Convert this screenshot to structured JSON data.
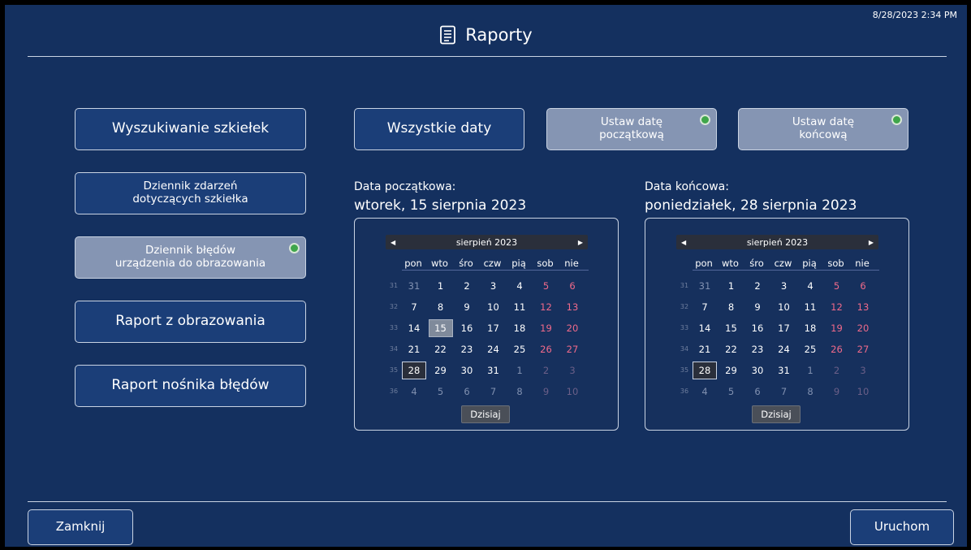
{
  "timestamp": "8/28/2023 2:34 PM",
  "header": {
    "title": "Raporty",
    "icon": "report-document-icon"
  },
  "left_menu": [
    {
      "id": "wyszukiwanie",
      "label": "Wyszukiwanie szkiełek",
      "size": "big",
      "dim": false,
      "indicator": false
    },
    {
      "id": "dziennik-zdarzen",
      "label_lines": [
        "Dziennik zdarzeń",
        "dotyczących szkiełka"
      ],
      "size": "small",
      "dim": false,
      "indicator": false
    },
    {
      "id": "dziennik-bledow",
      "label_lines": [
        "Dziennik błędów",
        "urządzenia do obrazowania"
      ],
      "size": "small",
      "dim": true,
      "indicator": true
    },
    {
      "id": "raport-obrazowania",
      "label": "Raport z obrazowania",
      "size": "big",
      "dim": false,
      "indicator": false
    },
    {
      "id": "raport-nosnika",
      "label": "Raport nośnika błędów",
      "size": "big",
      "dim": false,
      "indicator": false
    }
  ],
  "date_buttons": {
    "all_dates": "Wszystkie daty",
    "set_start": [
      "Ustaw datę",
      "początkową"
    ],
    "set_end": [
      "Ustaw datę",
      "końcową"
    ]
  },
  "start": {
    "caption": "Data początkowa:",
    "long_date": "wtorek, 15 sierpnia 2023",
    "month_label": "sierpień 2023",
    "selected_day": 15,
    "today_day": 28,
    "today_button": "Dzisiaj"
  },
  "end": {
    "caption": "Data końcowa:",
    "long_date": "poniedziałek, 28 sierpnia 2023",
    "month_label": "sierpień 2023",
    "selected_day": null,
    "today_day": 28,
    "today_button": "Dzisiaj"
  },
  "weekdays": [
    "pon",
    "wto",
    "śro",
    "czw",
    "pią",
    "sob",
    "nie"
  ],
  "weeks": [
    {
      "wk": "31",
      "days": [
        {
          "d": "31",
          "om": true
        },
        {
          "d": "1"
        },
        {
          "d": "2"
        },
        {
          "d": "3"
        },
        {
          "d": "4"
        },
        {
          "d": "5"
        },
        {
          "d": "6"
        }
      ]
    },
    {
      "wk": "32",
      "days": [
        {
          "d": "7"
        },
        {
          "d": "8"
        },
        {
          "d": "9"
        },
        {
          "d": "10"
        },
        {
          "d": "11"
        },
        {
          "d": "12"
        },
        {
          "d": "13"
        }
      ]
    },
    {
      "wk": "33",
      "days": [
        {
          "d": "14"
        },
        {
          "d": "15"
        },
        {
          "d": "16"
        },
        {
          "d": "17"
        },
        {
          "d": "18"
        },
        {
          "d": "19"
        },
        {
          "d": "20"
        }
      ]
    },
    {
      "wk": "34",
      "days": [
        {
          "d": "21"
        },
        {
          "d": "22"
        },
        {
          "d": "23"
        },
        {
          "d": "24"
        },
        {
          "d": "25"
        },
        {
          "d": "26"
        },
        {
          "d": "27"
        }
      ]
    },
    {
      "wk": "35",
      "days": [
        {
          "d": "28"
        },
        {
          "d": "29"
        },
        {
          "d": "30"
        },
        {
          "d": "31"
        },
        {
          "d": "1",
          "om": true
        },
        {
          "d": "2",
          "om": true
        },
        {
          "d": "3",
          "om": true
        }
      ]
    },
    {
      "wk": "36",
      "days": [
        {
          "d": "4",
          "om": true
        },
        {
          "d": "5",
          "om": true
        },
        {
          "d": "6",
          "om": true
        },
        {
          "d": "7",
          "om": true
        },
        {
          "d": "8",
          "om": true
        },
        {
          "d": "9",
          "om": true
        },
        {
          "d": "10",
          "om": true
        }
      ]
    }
  ],
  "footer": {
    "close": "Zamknij",
    "run": "Uruchom"
  },
  "colors": {
    "background": "#14305f",
    "button": "#1b3e78",
    "button_dim": "#8595b3",
    "weekend": "#f06a8a",
    "indicator": "#3fa64a"
  }
}
